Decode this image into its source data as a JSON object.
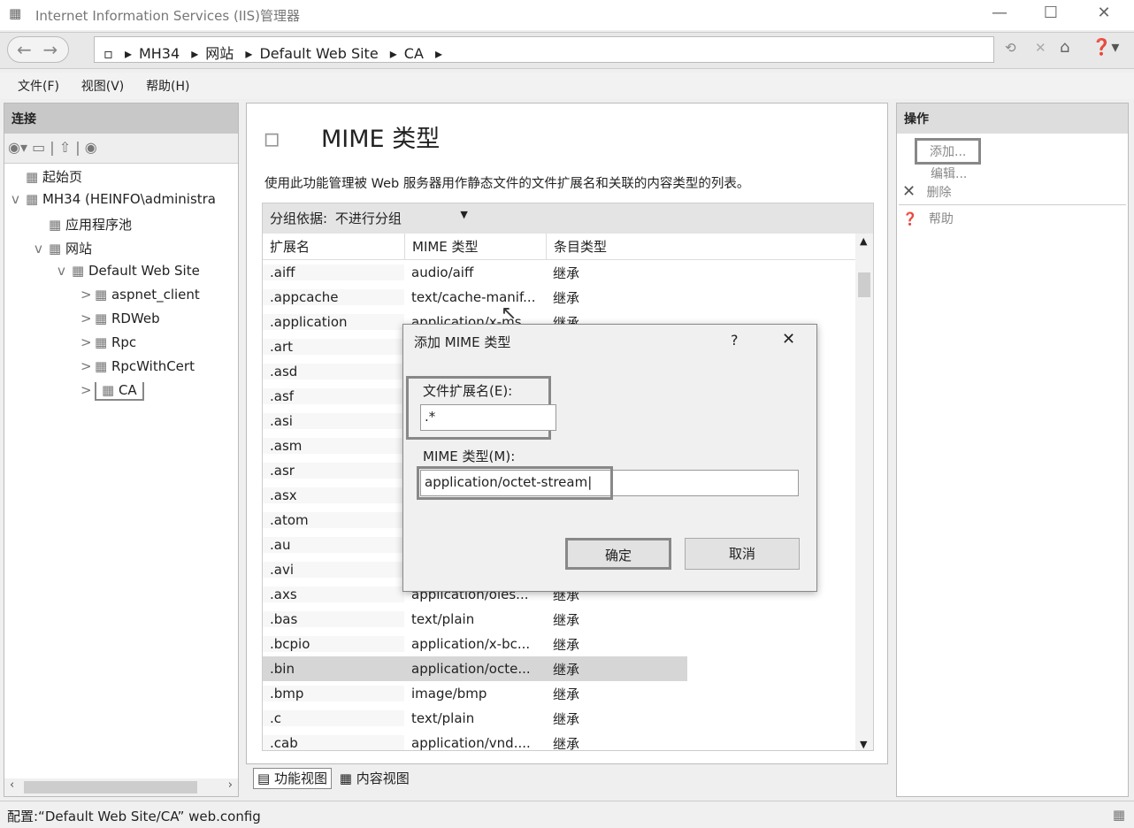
{
  "window": {
    "title": "Internet Information Services (IIS)管理器",
    "min": "—",
    "max": "☐",
    "close": "✕"
  },
  "address": {
    "crumbs": [
      "MH34",
      "网站",
      "Default Web Site",
      "CA"
    ]
  },
  "menu": [
    "文件(F)",
    "视图(V)",
    "帮助(H)"
  ],
  "connections": {
    "title": "连接",
    "tree": [
      {
        "label": "起始页",
        "indent": 0
      },
      {
        "label": "MH34 (HEINFO\\administra",
        "indent": 0,
        "arrow": "v"
      },
      {
        "label": "应用程序池",
        "indent": 1
      },
      {
        "label": "网站",
        "indent": 1,
        "arrow": "v"
      },
      {
        "label": "Default Web Site",
        "indent": 2,
        "arrow": "v"
      },
      {
        "label": "aspnet_client",
        "indent": 3,
        "arrow": ">"
      },
      {
        "label": "RDWeb",
        "indent": 3,
        "arrow": ">"
      },
      {
        "label": "Rpc",
        "indent": 3,
        "arrow": ">"
      },
      {
        "label": "RpcWithCert",
        "indent": 3,
        "arrow": ">"
      },
      {
        "label": "CA",
        "indent": 3,
        "arrow": ">",
        "selected": true
      }
    ]
  },
  "feature": {
    "title": "MIME 类型",
    "description": "使用此功能管理被 Web 服务器用作静态文件的文件扩展名和关联的内容类型的列表。",
    "group_label": "分组依据:",
    "group_value": "不进行分组",
    "columns": [
      "扩展名",
      "MIME 类型",
      "条目类型"
    ],
    "rows": [
      [
        ".aiff",
        "audio/aiff",
        "继承"
      ],
      [
        ".appcache",
        "text/cache-manif...",
        "继承"
      ],
      [
        ".application",
        "application/x-ms...",
        "继承"
      ],
      [
        ".art",
        "",
        ""
      ],
      [
        ".asd",
        "",
        ""
      ],
      [
        ".asf",
        "",
        ""
      ],
      [
        ".asi",
        "",
        ""
      ],
      [
        ".asm",
        "",
        ""
      ],
      [
        ".asr",
        "",
        ""
      ],
      [
        ".asx",
        "",
        ""
      ],
      [
        ".atom",
        "",
        ""
      ],
      [
        ".au",
        "",
        ""
      ],
      [
        ".avi",
        "",
        ""
      ],
      [
        ".axs",
        "application/oles...",
        "继承"
      ],
      [
        ".bas",
        "text/plain",
        "继承"
      ],
      [
        ".bcpio",
        "application/x-bc...",
        "继承"
      ],
      [
        ".bin",
        "application/octe...",
        "继承"
      ],
      [
        ".bmp",
        "image/bmp",
        "继承"
      ],
      [
        ".c",
        "text/plain",
        "继承"
      ],
      [
        ".cab",
        "application/vnd....",
        "继承"
      ]
    ],
    "selected_row": ".bin",
    "tabs": [
      "功能视图",
      "内容视图"
    ]
  },
  "actions": {
    "title": "操作",
    "items": [
      "添加...",
      "编辑...",
      "删除",
      "帮助"
    ]
  },
  "dialog": {
    "title": "添加 MIME 类型",
    "help": "?",
    "close": "✕",
    "ext_label": "文件扩展名(E):",
    "ext_value": ".*",
    "mime_label": "MIME 类型(M):",
    "mime_value": "application/octet-stream",
    "ok": "确定",
    "cancel": "取消"
  },
  "status": {
    "text": "配置:“Default Web Site/CA” web.config"
  }
}
